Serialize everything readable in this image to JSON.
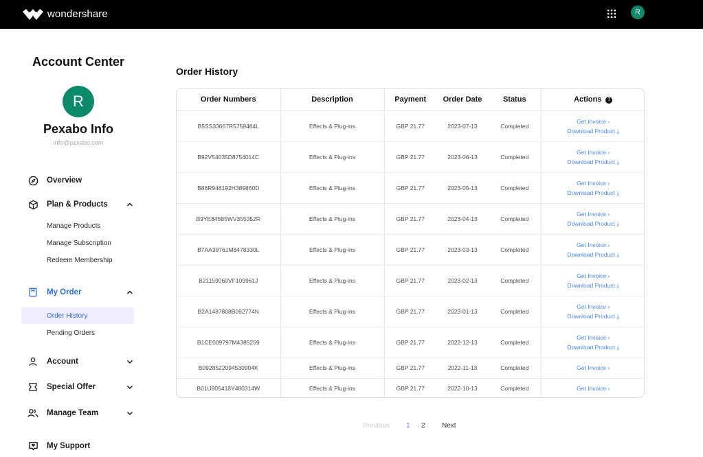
{
  "header": {
    "brand": "wondershare",
    "avatar_letter": "R",
    "colors": {
      "bar": "#000000",
      "avatar": "#0c8a6b"
    }
  },
  "sidebar": {
    "title": "Account Center",
    "avatar_letter": "R",
    "user_name": "Pexabo Info",
    "user_email": "info@pexabo.com",
    "nav": {
      "overview": "Overview",
      "plan_products": "Plan & Products",
      "manage_products": "Manage Products",
      "manage_subscription": "Manage Subscription",
      "redeem_membership": "Redeem Membership",
      "my_order": "My Order",
      "order_history": "Order History",
      "pending_orders": "Pending Orders",
      "account": "Account",
      "special_offer": "Special Offer",
      "manage_team": "Manage Team",
      "my_support": "My Support"
    },
    "accent_color": "#2f6fd8"
  },
  "main": {
    "title": "Order History",
    "columns": [
      "Order Numbers",
      "Description",
      "Payment",
      "Order Date",
      "Status",
      "Actions"
    ],
    "action_labels": {
      "invoice": "Get Invoice",
      "download": "Download Product"
    },
    "rows": [
      {
        "order": "B5SS33667R5759484L",
        "desc": "Effects & Plug-ins",
        "payment": "GBP 21.77",
        "date": "2023-07-13",
        "status": "Completed",
        "download": true
      },
      {
        "order": "B92V54035D8754014C",
        "desc": "Effects & Plug-ins",
        "payment": "GBP 21.77",
        "date": "2023-06-13",
        "status": "Completed",
        "download": true
      },
      {
        "order": "B86R948192H389860D",
        "desc": "Effects & Plug-ins",
        "payment": "GBP 21.77",
        "date": "2023-05-13",
        "status": "Completed",
        "download": true
      },
      {
        "order": "B9YE84585WV355352R",
        "desc": "Effects & Plug-ins",
        "payment": "GBP 21.77",
        "date": "2023-04-13",
        "status": "Completed",
        "download": true
      },
      {
        "order": "B7AA39761M8478330L",
        "desc": "Effects & Plug-ins",
        "payment": "GBP 21.77",
        "date": "2023-03-13",
        "status": "Completed",
        "download": true
      },
      {
        "order": "B21159060VF109961J",
        "desc": "Effects & Plug-ins",
        "payment": "GBP 21.77",
        "date": "2023-02-13",
        "status": "Completed",
        "download": true
      },
      {
        "order": "B2A1487808B092774N",
        "desc": "Effects & Plug-ins",
        "payment": "GBP 21.77",
        "date": "2023-01-13",
        "status": "Completed",
        "download": true
      },
      {
        "order": "B1CE009797M4385259",
        "desc": "Effects & Plug-ins",
        "payment": "GBP 21.77",
        "date": "2022-12-13",
        "status": "Completed",
        "download": true
      },
      {
        "order": "B092852209453090​4K",
        "desc": "Effects & Plug-ins",
        "payment": "GBP 21.77",
        "date": "2022-11-13",
        "status": "Completed",
        "download": false
      },
      {
        "order": "B01U805418Y480314W",
        "desc": "Effects & Plug-ins",
        "payment": "GBP 21.77",
        "date": "2022-10-13",
        "status": "Completed",
        "download": false
      }
    ],
    "link_color": "#4a86e8"
  },
  "pagination": {
    "previous": "Previous",
    "pages": [
      "1",
      "2"
    ],
    "current": "1",
    "next": "Next"
  }
}
